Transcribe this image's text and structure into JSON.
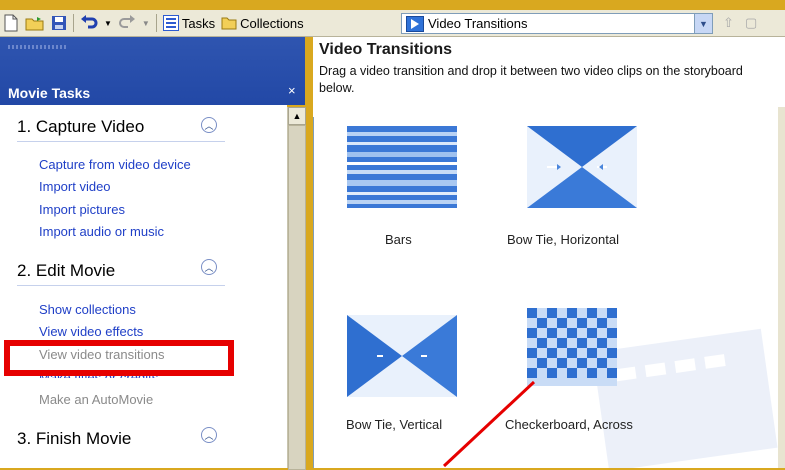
{
  "toolbar": {
    "tasks_label": "Tasks",
    "collections_label": "Collections",
    "combo_value": "Video Transitions"
  },
  "left_panel": {
    "header": "Movie Tasks",
    "close_glyph": "×",
    "sections": [
      {
        "title": "1. Capture Video",
        "links": [
          {
            "label": "Capture from video device",
            "enabled": true
          },
          {
            "label": "Import video",
            "enabled": true
          },
          {
            "label": "Import pictures",
            "enabled": true
          },
          {
            "label": "Import audio or music",
            "enabled": true
          }
        ]
      },
      {
        "title": "2. Edit Movie",
        "links": [
          {
            "label": "Show collections",
            "enabled": true
          },
          {
            "label": "View video effects",
            "enabled": true
          },
          {
            "label": "View video transitions",
            "enabled": false
          },
          {
            "label": "Make titles or credits",
            "enabled": true
          },
          {
            "label": "Make an AutoMovie",
            "enabled": false
          }
        ]
      },
      {
        "title": "3. Finish Movie",
        "links": []
      }
    ]
  },
  "right_pane": {
    "title": "Video Transitions",
    "description": "Drag a video transition and drop it between two video clips on the storyboard below.",
    "tiles": [
      {
        "caption": "Bars",
        "icon": "bars-transition-icon"
      },
      {
        "caption": "Bow Tie, Horizontal",
        "icon": "bow-tie-horizontal-icon"
      },
      {
        "caption": "Bow Tie, Vertical",
        "icon": "bow-tie-vertical-icon"
      },
      {
        "caption": "Checkerboard, Across",
        "icon": "checkerboard-across-icon"
      }
    ]
  },
  "colors": {
    "background": "#d9a81f",
    "panel_header": "#2f55b0",
    "link": "#1f3fc7",
    "highlight": "#e60000"
  }
}
